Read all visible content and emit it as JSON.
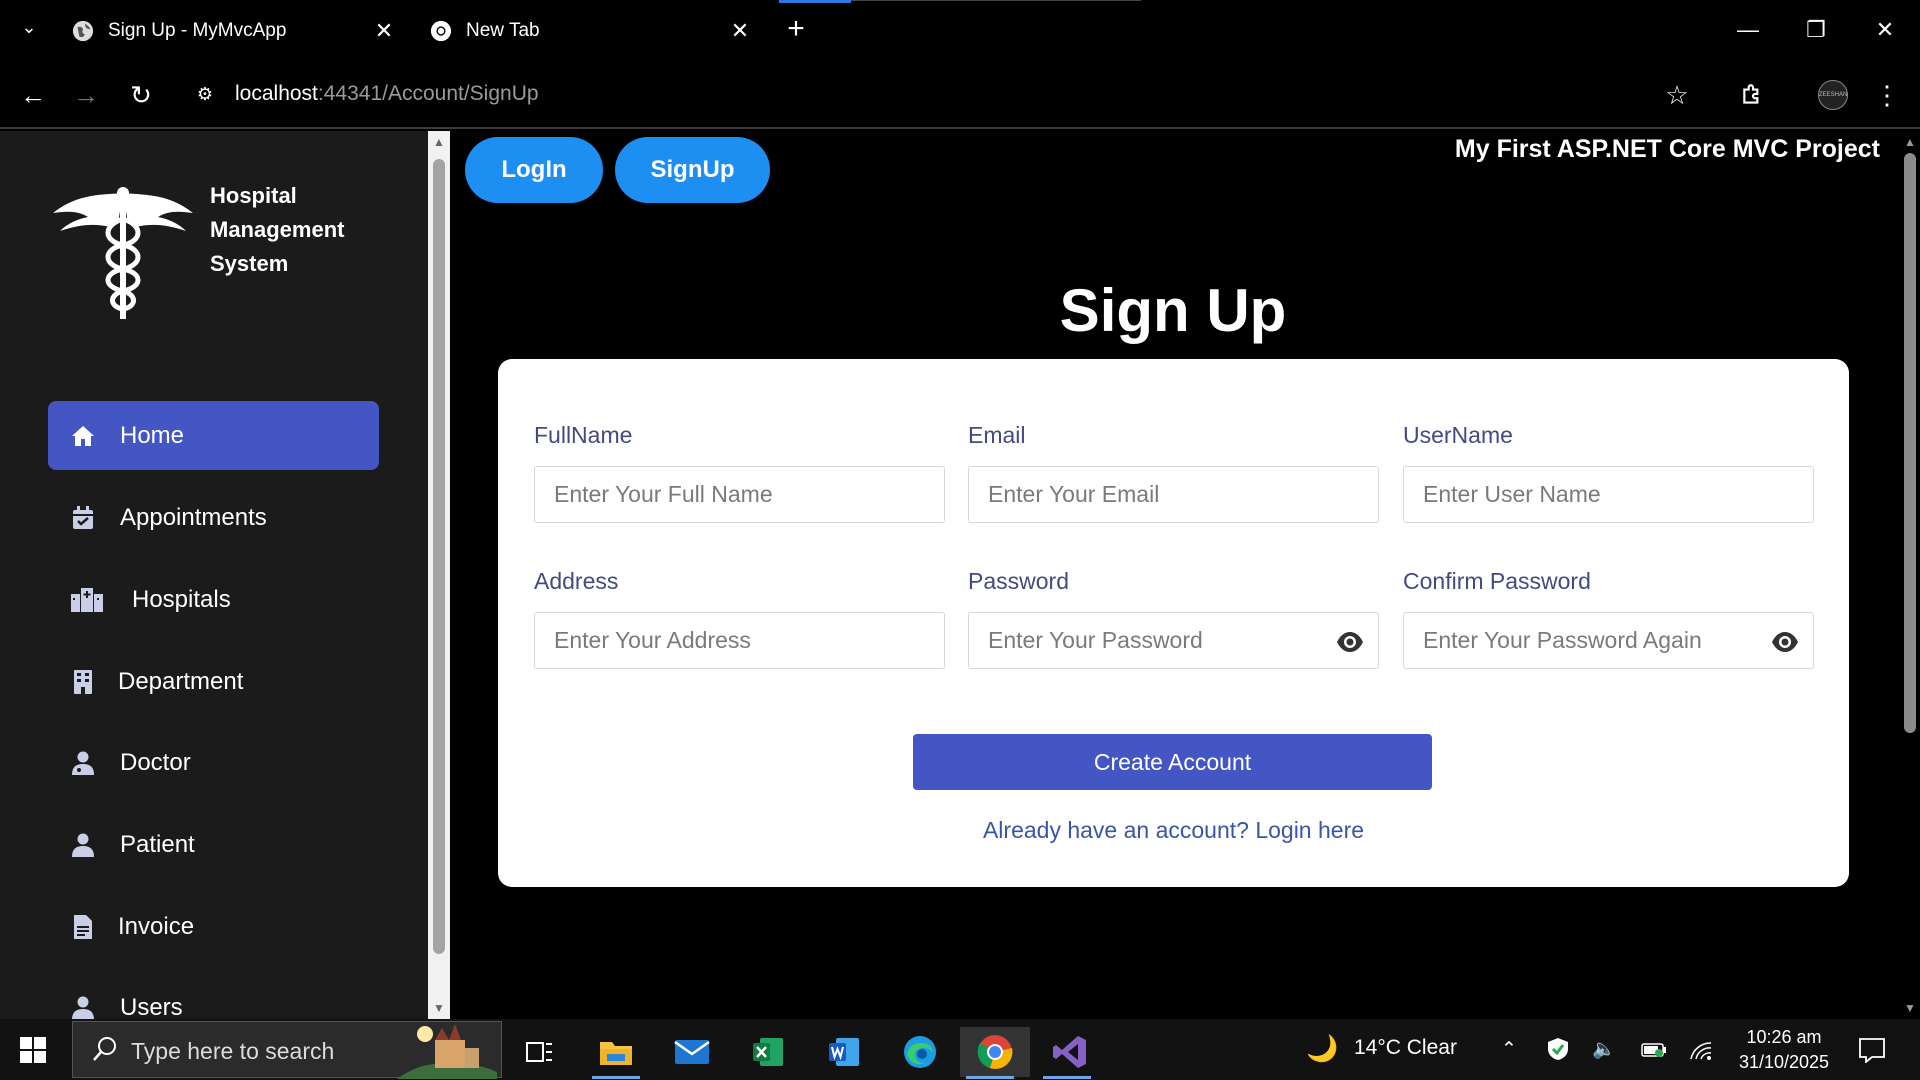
{
  "browser": {
    "tabs": [
      {
        "title": "Sign Up - MyMvcApp",
        "active": true
      },
      {
        "title": "New Tab",
        "active": false
      }
    ],
    "url_host": "localhost",
    "url_rest": ":44341/Account/SignUp",
    "profile_label": "ZEESHAN"
  },
  "sidebar": {
    "brand": [
      "Hospital",
      "Management",
      "System"
    ],
    "items": [
      {
        "label": "Home",
        "icon": "home-icon",
        "active": true
      },
      {
        "label": "Appointments",
        "icon": "calendar-check-icon"
      },
      {
        "label": "Hospitals",
        "icon": "hospital-buildings-icon"
      },
      {
        "label": "Department",
        "icon": "building-icon"
      },
      {
        "label": "Doctor",
        "icon": "doctor-icon"
      },
      {
        "label": "Patient",
        "icon": "user-icon"
      },
      {
        "label": "Invoice",
        "icon": "file-invoice-icon"
      },
      {
        "label": "Users",
        "icon": "user-icon"
      }
    ]
  },
  "header": {
    "login_label": "LogIn",
    "signup_label": "SignUp",
    "project_title": "My First ASP.NET Core MVC Project"
  },
  "form": {
    "title": "Sign Up",
    "fields": {
      "fullname": {
        "label": "FullName",
        "placeholder": "Enter Your Full Name",
        "value": ""
      },
      "email": {
        "label": "Email",
        "placeholder": "Enter Your Email",
        "value": ""
      },
      "username": {
        "label": "UserName",
        "placeholder": "Enter User Name",
        "value": ""
      },
      "address": {
        "label": "Address",
        "placeholder": "Enter Your Address",
        "value": ""
      },
      "password": {
        "label": "Password",
        "placeholder": "Enter Your Password",
        "value": ""
      },
      "confirm_password": {
        "label": "Confirm Password",
        "placeholder": "Enter Your Password Again",
        "value": ""
      }
    },
    "submit_label": "Create Account",
    "login_link": "Already have an account? Login here"
  },
  "taskbar": {
    "search_placeholder": "Type here to search",
    "weather": "14°C  Clear",
    "time": "10:26 am",
    "date": "31/10/2025"
  },
  "colors": {
    "accent": "#4356c4",
    "pill": "#1e8ff2",
    "sidebar_bg": "#1b1b1b",
    "label": "#444a7f"
  }
}
